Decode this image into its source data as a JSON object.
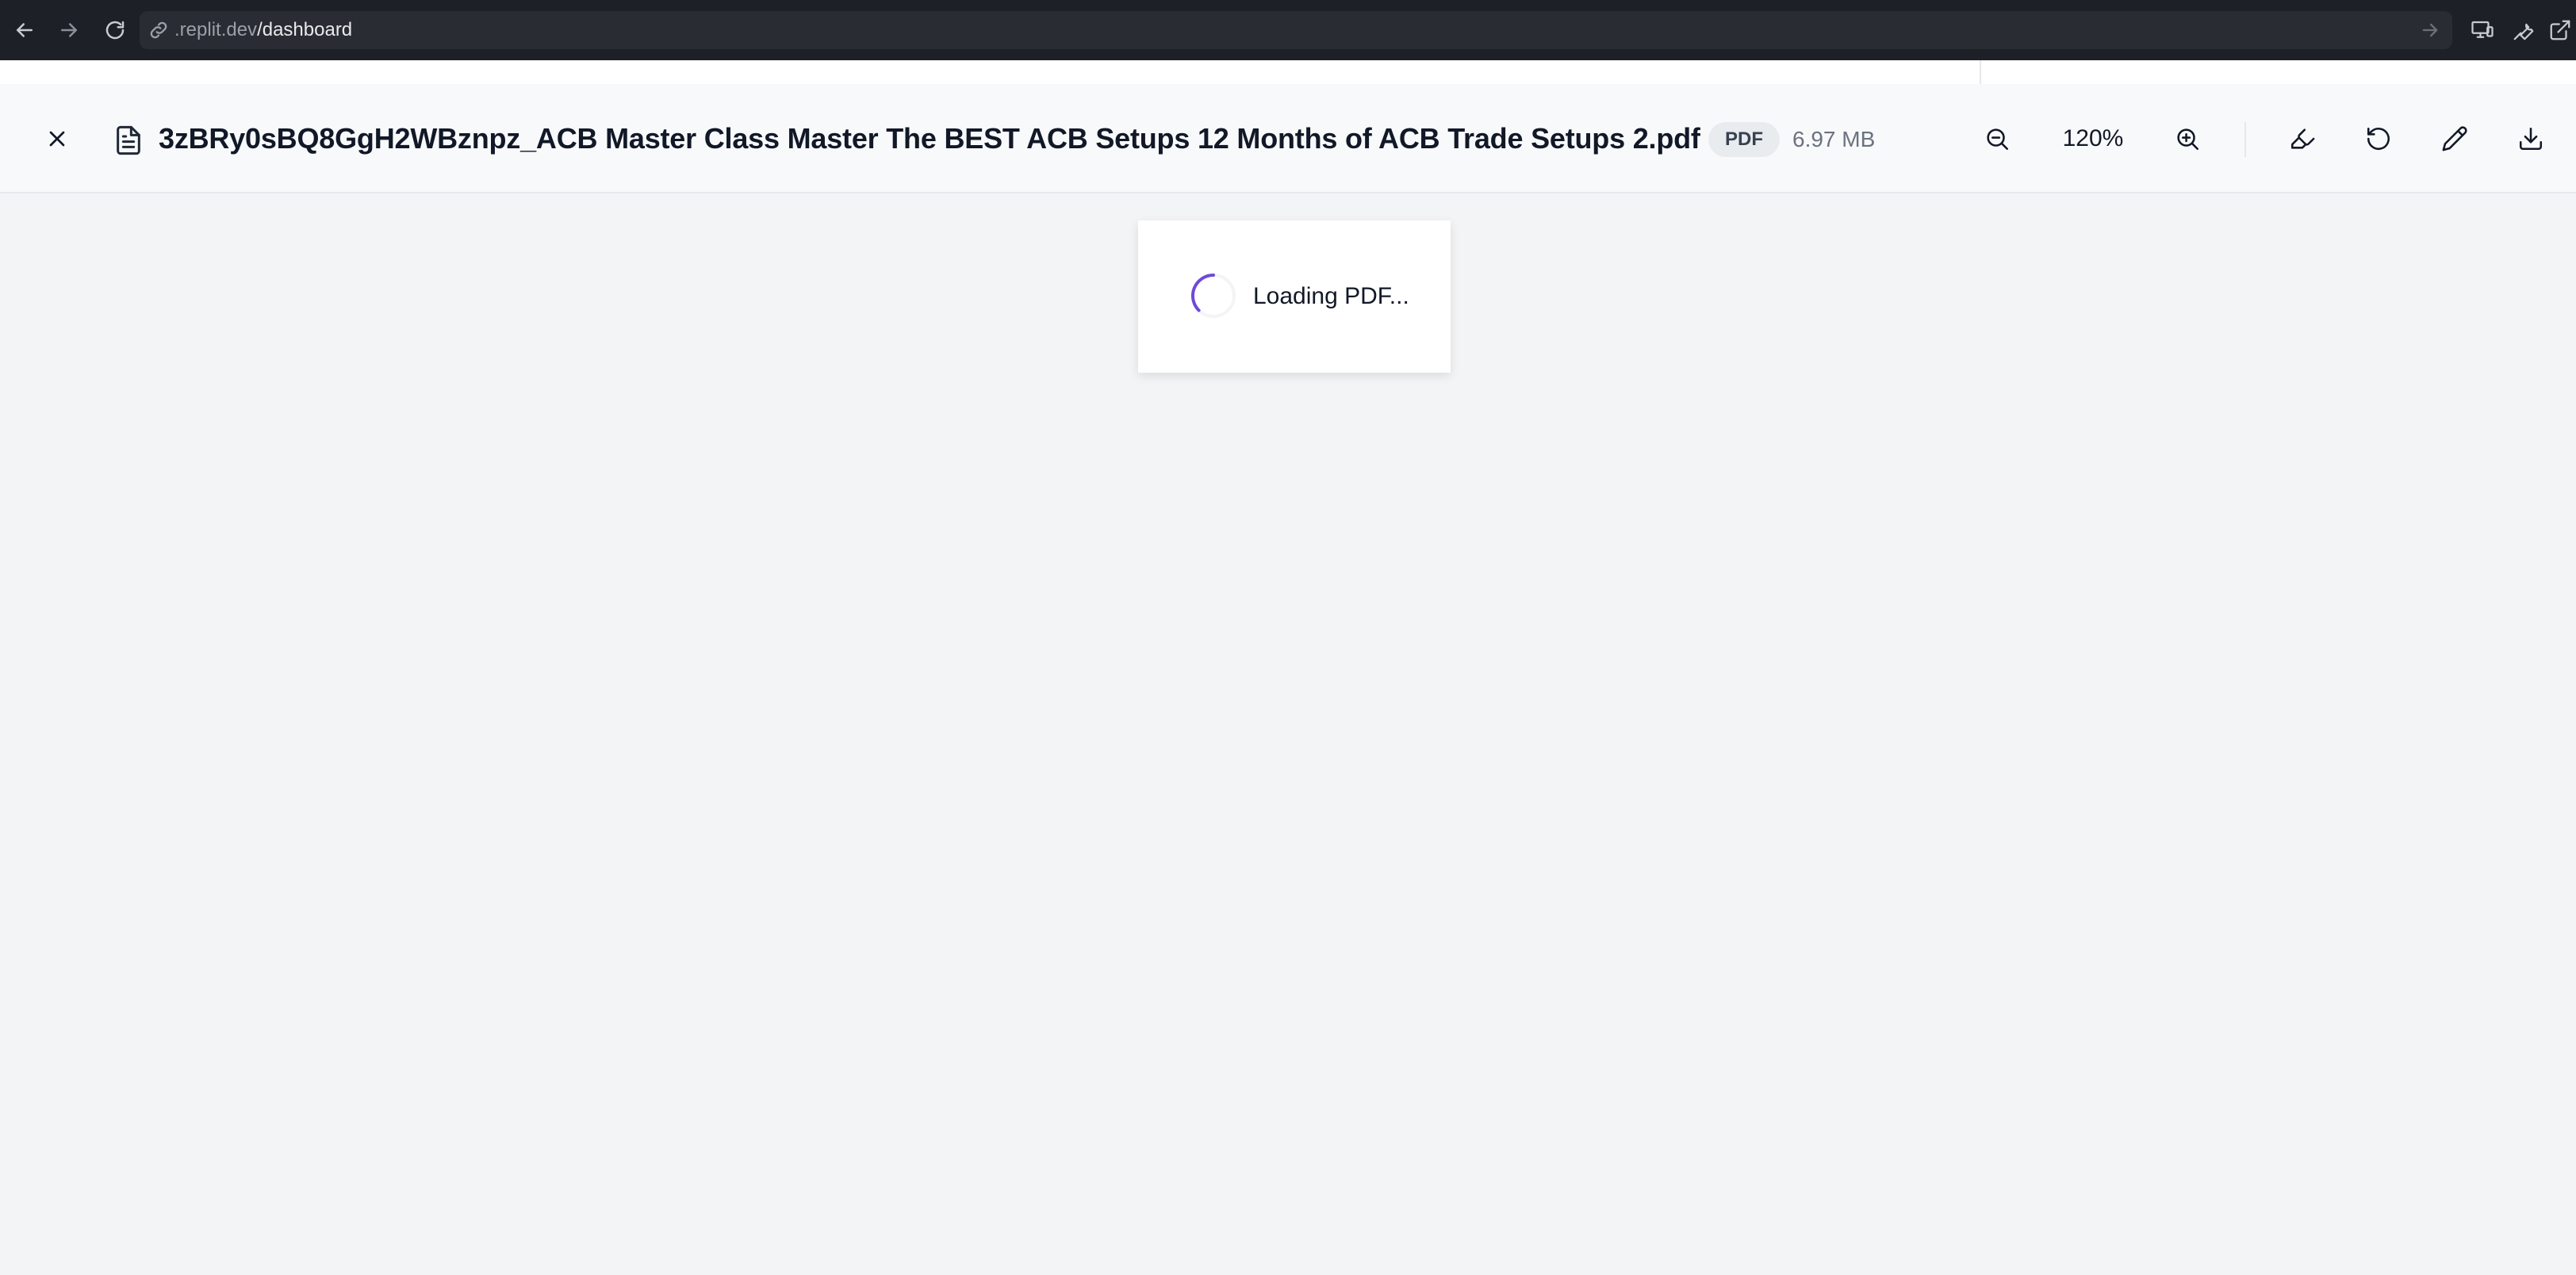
{
  "browser": {
    "url_host": ".replit.dev",
    "url_path": "/dashboard",
    "icons": [
      "arrow-left-icon",
      "arrow-right-icon",
      "refresh-icon",
      "link-icon",
      "arrow-go-icon",
      "monitor-icon",
      "wrench-icon",
      "external-link-icon"
    ]
  },
  "viewer": {
    "file_name": "3zBRy0sBQ8GgH2WBznpz_ACB Master Class Master The BEST ACB Setups 12 Months of ACB Trade Setups 2.pdf",
    "file_type": "PDF",
    "file_size": "6.97 MB",
    "zoom": "120%",
    "icons": [
      "close-icon",
      "file-icon",
      "zoom-out-icon",
      "zoom-in-icon",
      "highlighter-icon",
      "rotate-icon",
      "pen-icon",
      "download-icon"
    ]
  },
  "content": {
    "loading_text": "Loading PDF..."
  },
  "colors": {
    "browser_bar": "#1e2027",
    "header_bg": "#f8f9fa",
    "content_bg": "#f3f4f6",
    "spinner_accent": "#6d4ad8"
  }
}
